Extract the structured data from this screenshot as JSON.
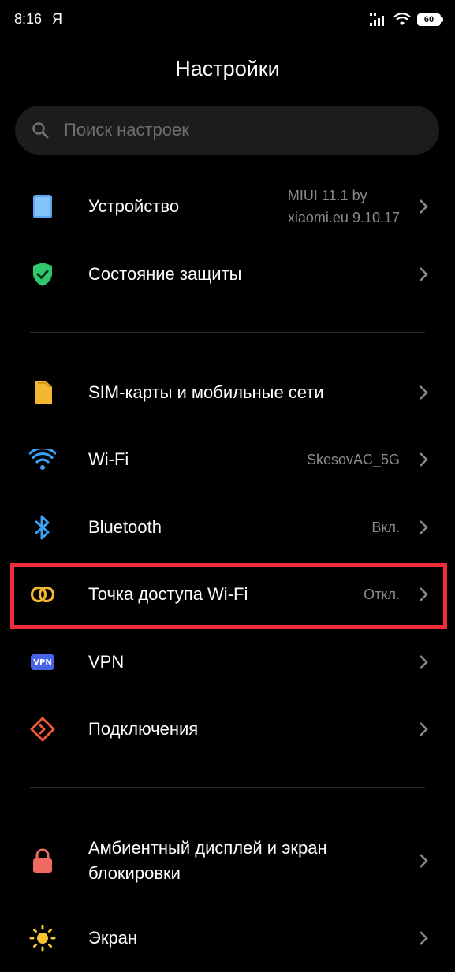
{
  "status_bar": {
    "time": "8:16",
    "carrier": "Я",
    "battery": "60"
  },
  "header": {
    "title": "Настройки"
  },
  "search": {
    "placeholder": "Поиск настроек"
  },
  "items": [
    {
      "label": "Устройство",
      "value_line1": "MIUI 11.1 by",
      "value_line2": "xiaomi.eu 9.10.17",
      "icon": "tablet-icon"
    },
    {
      "label": "Состояние защиты",
      "value": "",
      "icon": "shield-check-icon"
    },
    {
      "label": "SIM-карты и мобильные сети",
      "value": "",
      "icon": "sim-card-icon"
    },
    {
      "label": "Wi-Fi",
      "value": "SkesovAC_5G",
      "icon": "wifi-icon"
    },
    {
      "label": "Bluetooth",
      "value": "Вкл.",
      "icon": "bluetooth-icon"
    },
    {
      "label": "Точка доступа Wi-Fi",
      "value": "Откл.",
      "icon": "hotspot-icon"
    },
    {
      "label": "VPN",
      "value": "",
      "icon": "vpn-icon",
      "badge": "VPN"
    },
    {
      "label": "Подключения",
      "value": "",
      "icon": "connections-icon"
    },
    {
      "label_line1": "Амбиентный дисплей и экран",
      "label_line2": "блокировки",
      "value": "",
      "icon": "lock-icon"
    },
    {
      "label": "Экран",
      "value": "",
      "icon": "sun-icon"
    }
  ],
  "colors": {
    "background": "#000000",
    "highlight_border": "#ee2d3a",
    "secondary_text": "#8a8a8a"
  }
}
